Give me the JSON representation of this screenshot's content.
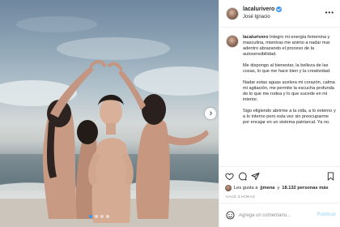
{
  "post": {
    "username": "lacalurivero",
    "location": "José Ignacio",
    "verified": true
  },
  "caption": {
    "username": "lacalurivero",
    "paragraphs": [
      "Integro mi energía femenina y masculina, mientras me animo a nadar mar adentro abrazando el proceso de la autosensibilidad.",
      "Me dispongo al bienestar, la belleza de las cosas, lo que me hace bien y la creatividad.",
      "Nadar estas aguas acelera mi corazón, calma mi agitación, me permite la escucha profunda de lo que me rodea y lo que sucede en mi interior.",
      "Sigo eligiendo abrirme a la vida, a lo externo y a lo interno pero esta vez sin preocuparme por encajar en un sistema patriarcal. Ya no."
    ]
  },
  "likes": {
    "prefix": "Les gusta a",
    "user": "jjmena",
    "connector": "y",
    "count": "18.132 personas más"
  },
  "timestamp": "HACE 3 HORAS",
  "comment": {
    "placeholder": "Agrega un comentario...",
    "publish_label": "Publicar"
  },
  "carousel": {
    "slide_count": 4,
    "active_index": 0
  },
  "icons": {
    "more": "more-horizontal-icon",
    "like": "heart-icon",
    "comment": "comment-icon",
    "share": "paper-plane-icon",
    "save": "bookmark-icon",
    "emoji": "smiley-icon",
    "next": "chevron-right-icon"
  },
  "colors": {
    "accent": "#3897f0",
    "publish_disabled": "#b2dffc",
    "text": "#262626",
    "muted": "#8e8e8e"
  }
}
